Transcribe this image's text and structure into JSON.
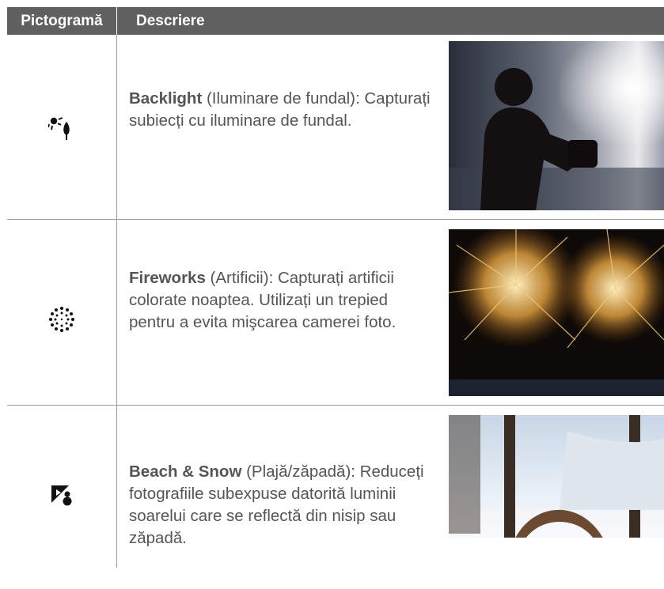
{
  "header": {
    "col_icon": "Pictogramă",
    "col_desc": "Descriere"
  },
  "rows": [
    {
      "icon": "backlight-icon",
      "title": "Backlight",
      "text": " (Iluminare de fundal): Capturați subiecți cu iluminare de fundal."
    },
    {
      "icon": "fireworks-icon",
      "title": "Fireworks",
      "text": " (Artificii): Capturați artificii colorate noaptea. Utilizați un trepied pentru a evita mişcarea camerei foto."
    },
    {
      "icon": "beach-snow-icon",
      "title": "Beach & Snow",
      "text": " (Plajă/zăpadă): Reduceți fotografiile subexpuse datorită luminii soarelui care se reflectă din nisip sau zăpadă."
    }
  ],
  "colors": {
    "header_bg": "#606060",
    "text": "#555555",
    "rule": "#9a9a9a"
  }
}
